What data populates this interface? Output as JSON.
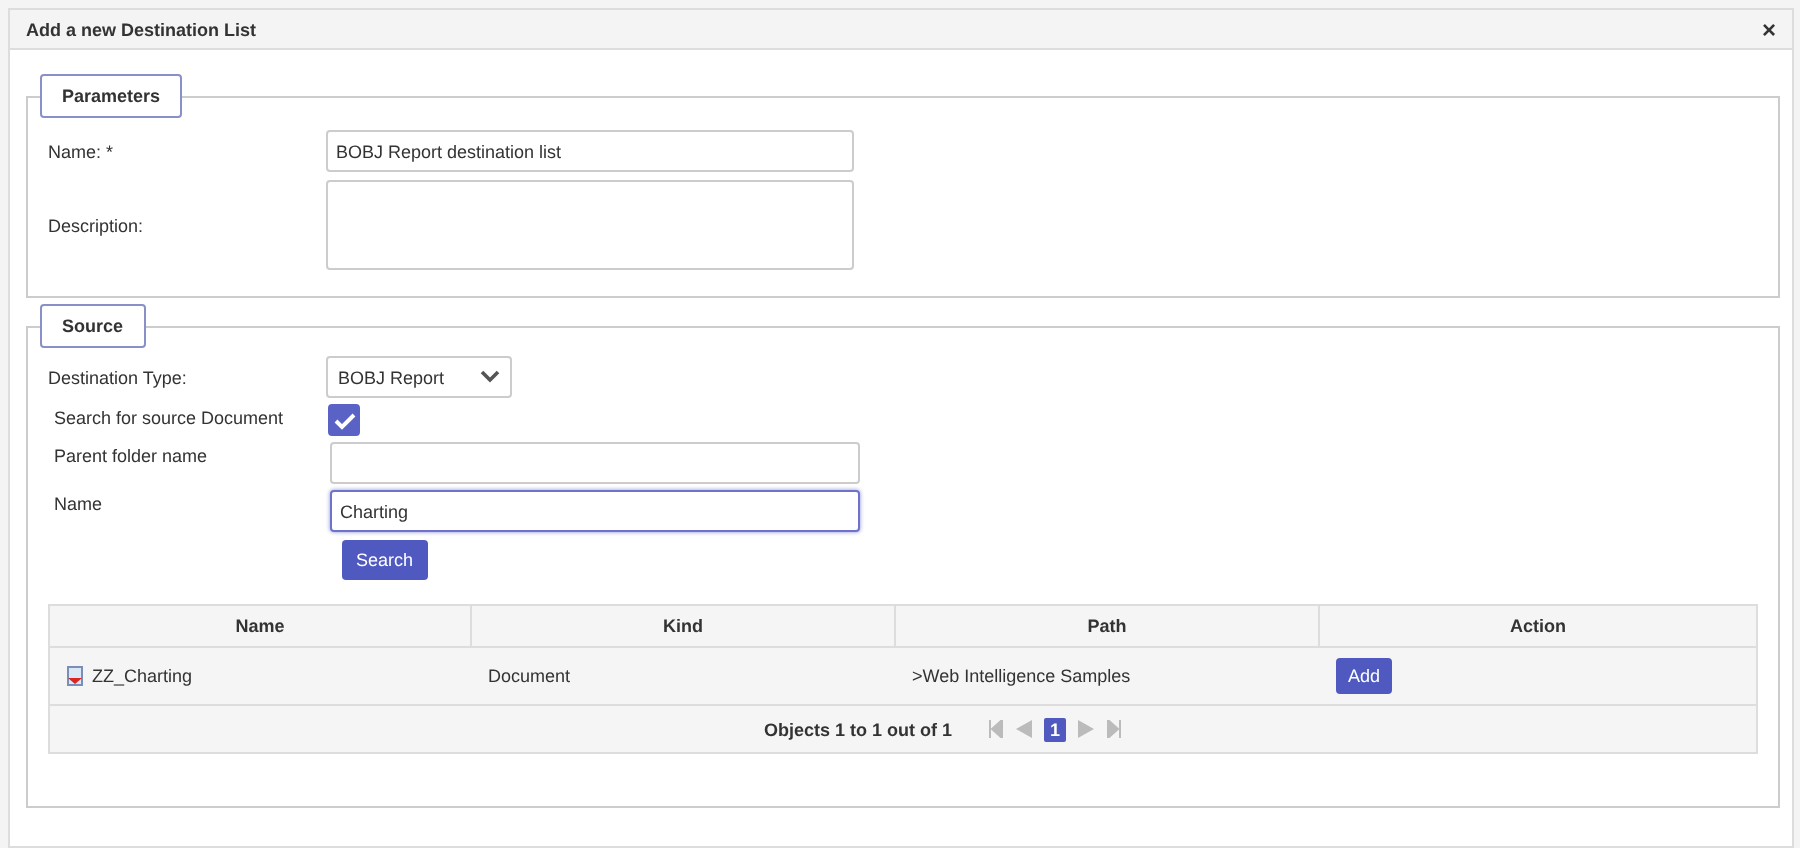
{
  "window": {
    "title": "Add a new Destination List",
    "close": "×"
  },
  "parameters": {
    "legend": "Parameters",
    "name_label": "Name: *",
    "name_value": "BOBJ Report destination list",
    "description_label": "Description:"
  },
  "source": {
    "legend": "Source",
    "type_label": "Destination Type:",
    "type_value": "BOBJ Report",
    "search_doc_label": "Search for source Document",
    "search_doc_checked": true,
    "parent_label": "Parent folder name",
    "name_label": "Name",
    "name_value": "Charting",
    "name_focused": true,
    "search_button": "Search"
  },
  "table": {
    "columns": [
      "Name",
      "Kind",
      "Path",
      "Action"
    ],
    "rows": [
      {
        "name": "ZZ_Charting",
        "kind": "Document",
        "path": ">Web Intelligence Samples",
        "action": "Add"
      }
    ],
    "footer": "Objects 1 to 1 out of 1",
    "pages": [
      {
        "label": "1",
        "selected": true
      }
    ]
  }
}
